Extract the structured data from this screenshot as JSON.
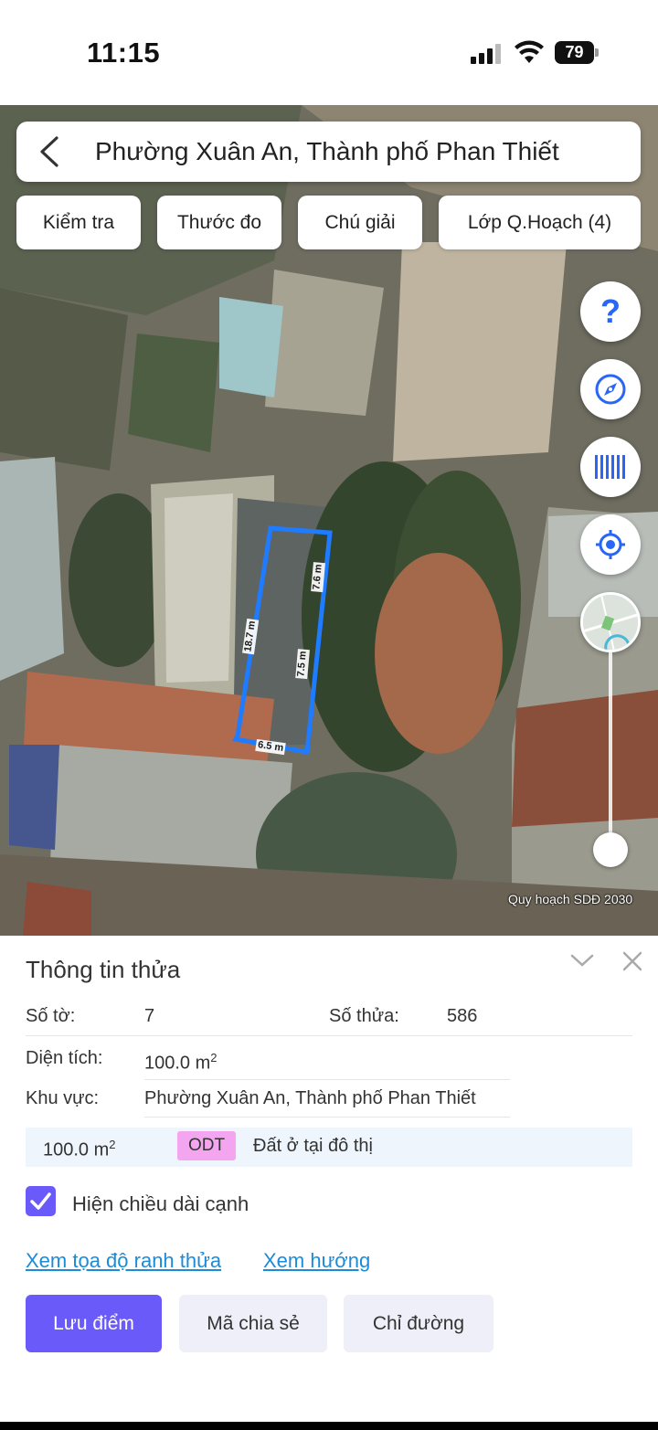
{
  "status_bar": {
    "time": "11:15",
    "battery": "79"
  },
  "search": {
    "title": "Phường Xuân An, Thành phố Phan Thiết"
  },
  "chips": [
    {
      "label": "Kiểm tra"
    },
    {
      "label": "Thước đo"
    },
    {
      "label": "Chú giải"
    },
    {
      "label": "Lớp Q.Hoạch (4)"
    }
  ],
  "map": {
    "fab_help_label": "?",
    "credit": "Quy hoạch SDĐ 2030",
    "edge_lengths": [
      "7.6 m",
      "18.7 m",
      "7.5 m",
      "6.5 m"
    ]
  },
  "colors": {
    "accent": "#6a5af9",
    "link": "#1c8bd8",
    "plot_outline": "#1f7bff",
    "odt_badge": "#f3a5f0"
  },
  "icons": [
    "back-icon",
    "help-icon",
    "compass-icon",
    "barcode-icon",
    "locate-icon",
    "chevron-down-icon",
    "close-icon",
    "checkmark-icon"
  ],
  "parcel": {
    "title": "Thông tin thửa",
    "sheet_label": "Số tờ:",
    "sheet_value": "7",
    "plot_label": "Số thửa:",
    "plot_value": "586",
    "area_label": "Diện tích:",
    "area_value": "100.0 m",
    "area_unit_sup": "2",
    "region_label": "Khu vực:",
    "region_value": "Phường Xuân An, Thành phố Phan Thiết",
    "land_use": {
      "area": "100.0 m",
      "area_sup": "2",
      "code": "ODT",
      "description": "Đất ở tại đô thị"
    },
    "show_edges_label": "Hiện chiều dài cạnh",
    "show_edges_checked": true,
    "links": {
      "coords": "Xem tọa độ ranh thửa",
      "direction": "Xem hướng"
    },
    "buttons": {
      "save": "Lưu điểm",
      "share": "Mã chia sẻ",
      "directions": "Chỉ đường"
    }
  }
}
